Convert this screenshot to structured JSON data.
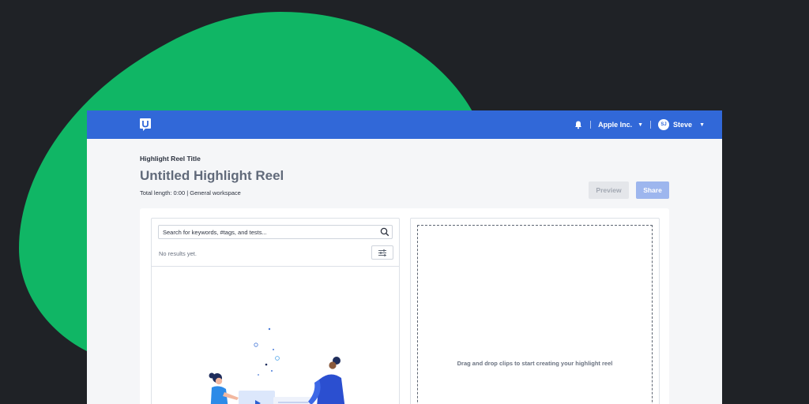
{
  "colors": {
    "background": "#1f2226",
    "blob": "#10b665",
    "topbar": "#3168d8",
    "share_button": "#9db6ee",
    "preview_button": "#e4e6ea"
  },
  "topbar": {
    "logo_icon": "usertesting-logo-icon",
    "bell_icon": "bell-icon",
    "account_name": "Apple Inc.",
    "avatar_initials": "SJ",
    "user_name": "Steve"
  },
  "header": {
    "label": "Highlight Reel Title",
    "title": "Untitled Highlight Reel",
    "meta": "Total length: 0:00 | General workspace",
    "preview_label": "Preview",
    "share_label": "Share"
  },
  "search": {
    "placeholder": "Search for keywords, #tags, and tests...",
    "icon": "search-icon",
    "filter_icon": "filter-sliders-icon"
  },
  "results": {
    "empty_text": "No results yet."
  },
  "dropzone": {
    "text": "Drag and drop clips to start creating your highlight reel"
  }
}
